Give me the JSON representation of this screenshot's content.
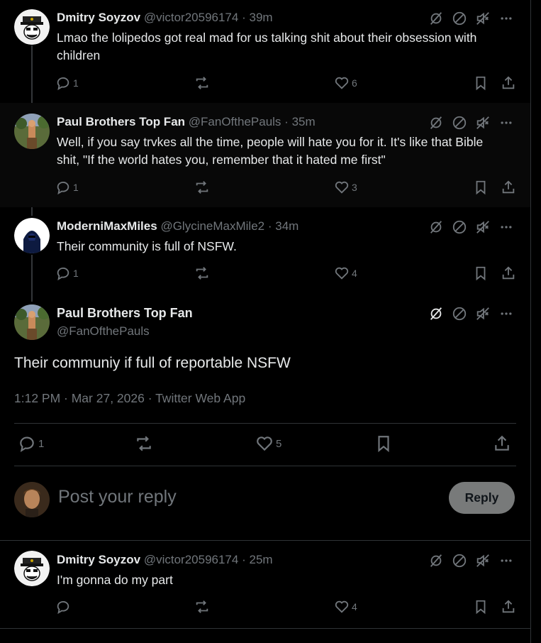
{
  "replies_above": [
    {
      "author": {
        "name": "Dmitry Soyzov",
        "handle": "@victor20596174",
        "time": "39m"
      },
      "text": "Lmao the lolipedos got real mad for us talking shit about their obsession with children",
      "stats": {
        "replies": "1",
        "reposts": "",
        "likes": "6"
      }
    },
    {
      "author": {
        "name": "Paul Brothers Top Fan",
        "handle": "@FanOfthePauls",
        "time": "35m"
      },
      "text": "Well, if you say trvkes all the time, people will hate you for it. It's like that Bible shit, \"If the world hates you, remember that it hated me first\"",
      "stats": {
        "replies": "1",
        "reposts": "",
        "likes": "3"
      }
    },
    {
      "author": {
        "name": "ModerniMaxMiles",
        "handle": "@GlycineMaxMile2",
        "time": "34m"
      },
      "text": "Their community is full of NSFW.",
      "stats": {
        "replies": "1",
        "reposts": "",
        "likes": "4"
      }
    }
  ],
  "main_post": {
    "author": {
      "name": "Paul Brothers Top Fan",
      "handle": "@FanOfthePauls"
    },
    "text": "Their communiy if full of reportable NSFW",
    "meta": "1:12 PM · Mar 27, 2026 · Twitter Web App",
    "stats": {
      "replies": "1",
      "reposts": "",
      "likes": "5"
    }
  },
  "composer": {
    "placeholder": "Post your reply",
    "button_label": "Reply"
  },
  "replies_below": [
    {
      "author": {
        "name": "Dmitry Soyzov",
        "handle": "@victor20596174",
        "time": "25m"
      },
      "text": "I'm gonna do my part",
      "stats": {
        "replies": "",
        "reposts": "",
        "likes": "4"
      }
    }
  ],
  "dot_separator": "·",
  "icons": {
    "mod": [
      "hide-reply-icon",
      "block-icon",
      "mute-icon",
      "more-icon"
    ],
    "actions": [
      "reply-icon",
      "repost-icon",
      "like-icon",
      "bookmark-icon",
      "share-icon"
    ]
  },
  "colors": {
    "background": "#000000",
    "text": "#e7e9ea",
    "muted": "#71767b",
    "border": "#2f3336",
    "reply_button": "#787a7a"
  }
}
